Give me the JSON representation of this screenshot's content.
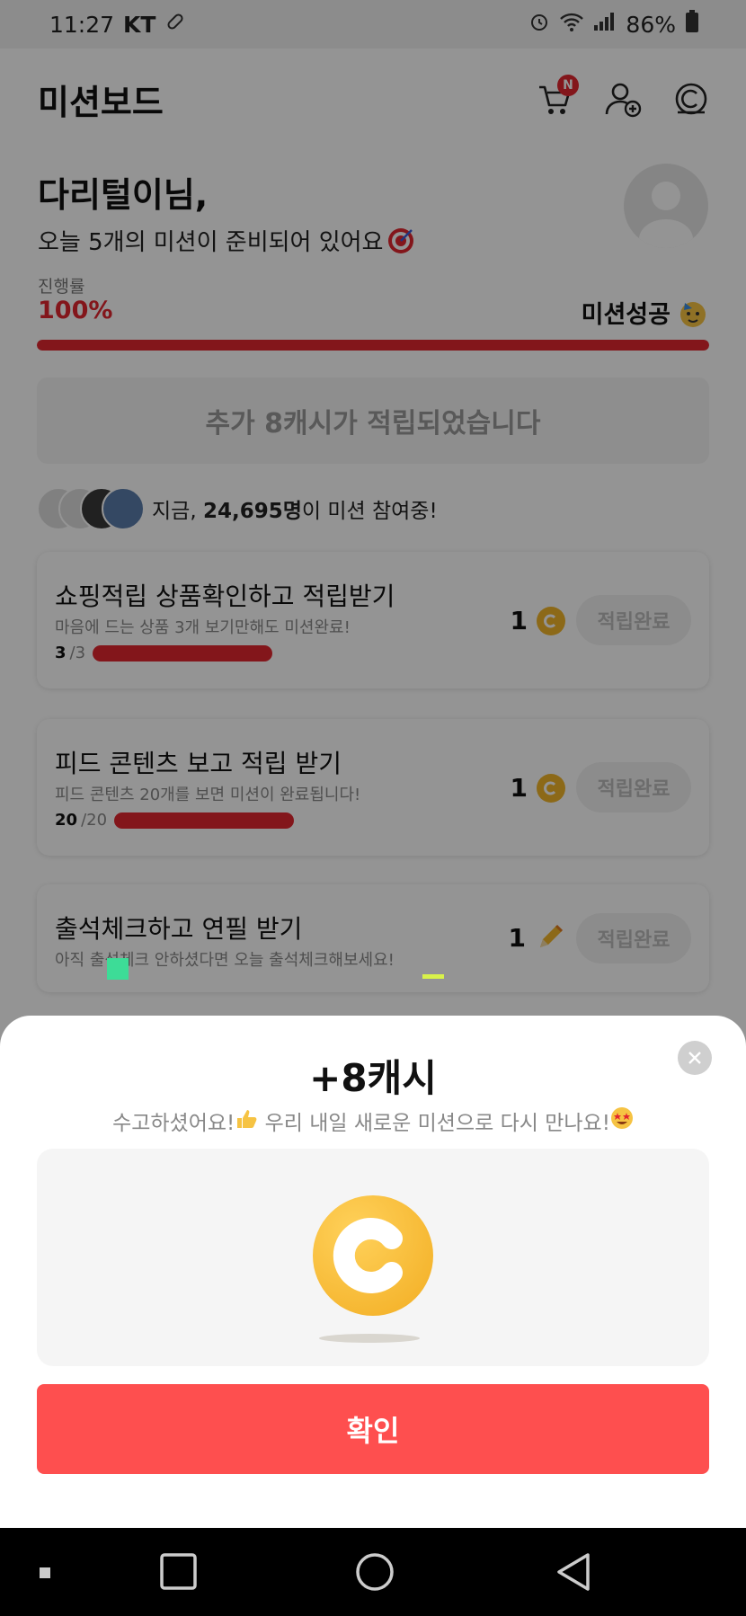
{
  "status_bar": {
    "time": "11:27",
    "carrier": "KT",
    "battery": "86%"
  },
  "header": {
    "title": "미션보드",
    "cart_badge": "N",
    "icons": [
      "cart-icon",
      "add-friend-icon",
      "cash-icon"
    ]
  },
  "greeting": {
    "name": "다리털이님,",
    "subtitle": "오늘 5개의 미션이 준비되어 있어요",
    "subtitle_emoji": "target-emoji"
  },
  "progress": {
    "label": "진행률",
    "value": "100%",
    "fraction": 1.0,
    "status": "미션성공"
  },
  "banner": {
    "text": "추가 8캐시가 적립되었습니다"
  },
  "participants": {
    "prefix": "지금, ",
    "count": "24,695명",
    "suffix": "이 미션 참여중!"
  },
  "missions": [
    {
      "title": "쇼핑적립 상품확인하고 적립받기",
      "desc": "마음에 드는 상품 3개 보기만해도 미션완료!",
      "done": "3",
      "total": "/3",
      "progress": 1.0,
      "reward": "1",
      "reward_icon": "coin-icon",
      "button": "적립완료"
    },
    {
      "title": "피드 콘텐츠 보고 적립 받기",
      "desc": "피드 콘텐츠 20개를 보면 미션이 완료됩니다!",
      "done": "20",
      "total": "/20",
      "progress": 1.0,
      "reward": "1",
      "reward_icon": "coin-icon",
      "button": "적립완료"
    },
    {
      "title": "출석체크하고 연필 받기",
      "desc": "아직 출석체크 안하셨다면 오늘 출석체크해보세요!",
      "reward": "1",
      "reward_icon": "pencil-icon",
      "button": "적립완료"
    }
  ],
  "sheet": {
    "title": "+8캐시",
    "subtitle_a": "수고하셨어요!",
    "subtitle_b": " 우리 내일 새로운 미션으로 다시 만나요!",
    "confirm": "확인"
  },
  "colors": {
    "accent": "#e2262f",
    "confirm": "#fe4f4f",
    "coin": "#f2b62a"
  }
}
